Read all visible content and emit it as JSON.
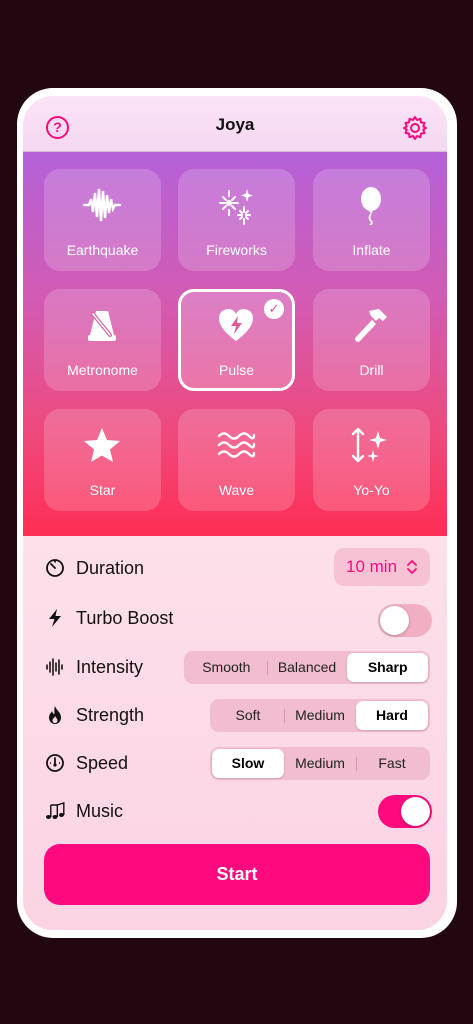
{
  "header": {
    "title": "Joya",
    "help_label": "?"
  },
  "modes": [
    {
      "label": "Earthquake",
      "icon": "waveform-icon"
    },
    {
      "label": "Fireworks",
      "icon": "fireworks-icon"
    },
    {
      "label": "Inflate",
      "icon": "balloon-icon"
    },
    {
      "label": "Metronome",
      "icon": "metronome-icon"
    },
    {
      "label": "Pulse",
      "icon": "bolt-heart-icon",
      "selected": true
    },
    {
      "label": "Drill",
      "icon": "hammer-icon"
    },
    {
      "label": "Star",
      "icon": "star-icon"
    },
    {
      "label": "Wave",
      "icon": "water-waves-icon"
    },
    {
      "label": "Yo-Yo",
      "icon": "arrows-sparkles-icon"
    }
  ],
  "settings": {
    "duration": {
      "label": "Duration",
      "value": "10 min"
    },
    "turbo": {
      "label": "Turbo Boost",
      "on": false
    },
    "intensity": {
      "label": "Intensity",
      "options": [
        "Smooth",
        "Balanced",
        "Sharp"
      ],
      "selected": "Sharp"
    },
    "strength": {
      "label": "Strength",
      "options": [
        "Soft",
        "Medium",
        "Hard"
      ],
      "selected": "Hard"
    },
    "speed": {
      "label": "Speed",
      "options": [
        "Slow",
        "Medium",
        "Fast"
      ],
      "selected": "Slow"
    },
    "music": {
      "label": "Music",
      "on": true
    }
  },
  "start_label": "Start",
  "colors": {
    "accent": "#ff0a7e",
    "background": "#230710"
  }
}
